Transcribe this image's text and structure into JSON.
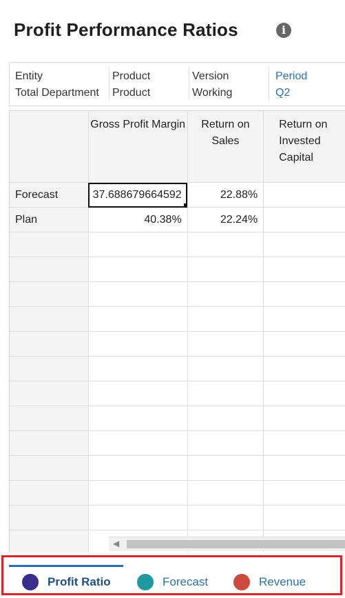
{
  "page": {
    "title": "Profit Performance Ratios"
  },
  "pov": [
    {
      "label": "Entity",
      "value": "Total Department"
    },
    {
      "label": "Product",
      "value": "Product"
    },
    {
      "label": "Version",
      "value": "Working"
    },
    {
      "label": "Period",
      "value": "Q2"
    }
  ],
  "grid": {
    "columns": [
      "Gross Profit Margin",
      "Return on Sales",
      "Return on Invested Capital"
    ],
    "rows": [
      {
        "label": "Forecast",
        "values": [
          "37.688679664592",
          "22.88%",
          ""
        ]
      },
      {
        "label": "Plan",
        "values": [
          "40.38%",
          "22.24%",
          ""
        ]
      }
    ]
  },
  "tabs": [
    {
      "label": "Profit Ratio",
      "color": "#3a2f8c",
      "active": true
    },
    {
      "label": "Forecast",
      "color": "#1e9aa0",
      "active": false
    },
    {
      "label": "Revenue",
      "color": "#cc4a3f",
      "active": false
    }
  ],
  "icons": {
    "info": "info-circle-icon",
    "scroll_left": "chevron-left-icon"
  }
}
